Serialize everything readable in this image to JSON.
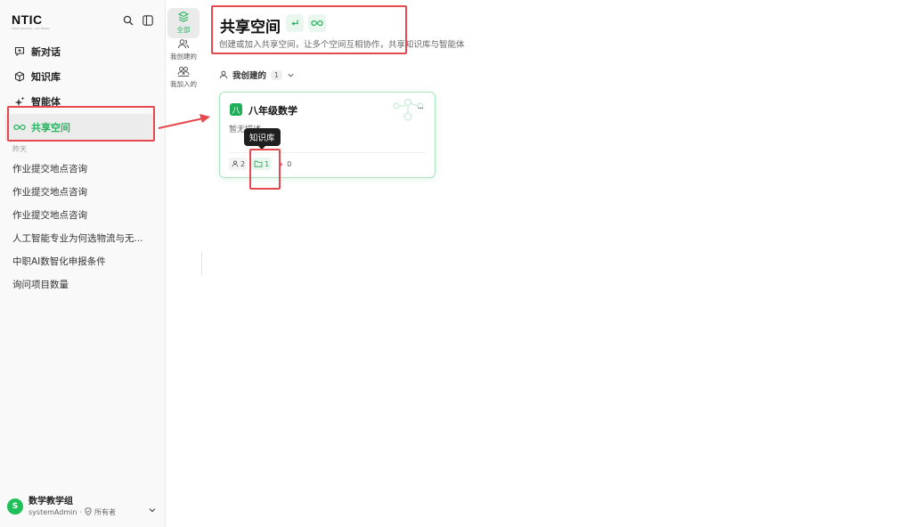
{
  "brand": {
    "name": "NTIC",
    "tagline": "Think Smarter, Act Faster"
  },
  "sidebar": {
    "nav": [
      {
        "label": "新对话",
        "icon": "new-chat-icon"
      },
      {
        "label": "知识库",
        "icon": "knowledge-base-icon"
      },
      {
        "label": "智能体",
        "icon": "sparkle-icon"
      },
      {
        "label": "共享空间",
        "icon": "infinity-icon",
        "active": true
      }
    ],
    "history_label": "昨天",
    "history": [
      "作业提交地点咨询",
      "作业提交地点咨询",
      "作业提交地点咨询",
      "人工智能专业为何选物流与无...",
      "中职AI数智化申报条件",
      "询问项目数量"
    ],
    "user": {
      "initial": "S",
      "name": "数学教学组",
      "account": "systemAdmin",
      "separator": "·",
      "role": "所有者"
    }
  },
  "subnav": [
    {
      "label": "全部",
      "icon": "layers-icon",
      "active": true
    },
    {
      "label": "我创建的",
      "icon": "user-group-icon"
    },
    {
      "label": "我加入的",
      "icon": "joined-users-icon"
    }
  ],
  "main": {
    "title": "共享空间",
    "subtitle": "创建或加入共享空间，让多个空间互相协作，共享知识库与智能体",
    "section": {
      "label": "我创建的",
      "count": "1"
    },
    "card": {
      "badge": "八",
      "title": "八年级数学",
      "more": "...",
      "description": "暂无描述",
      "members": "2",
      "knowledge_bases": "1",
      "agents": "0"
    },
    "tooltip": "知识库"
  },
  "colors": {
    "accent": "#2bb563",
    "highlight": "#e5484d"
  }
}
